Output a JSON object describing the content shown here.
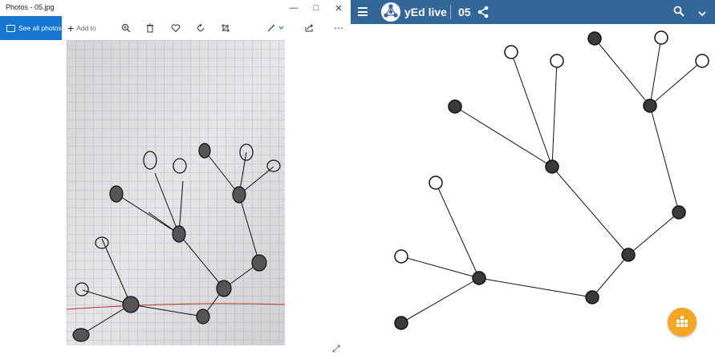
{
  "photos_window": {
    "title": "Photos - 05.jpg",
    "toolbar": {
      "see_all_label": "See all photos",
      "add_to_label": "Add to",
      "icons": [
        "zoom-in-icon",
        "delete-icon",
        "heart-icon",
        "rotate-icon",
        "crop-icon",
        "edit-icon",
        "share-icon",
        "more-icon"
      ]
    },
    "accent_color": "#1677d2"
  },
  "yed_window": {
    "app_name": "yEd live",
    "file_name": "05",
    "header_color": "#336699",
    "fab_color": "#f5a623",
    "graph": {
      "node_colors": {
        "filled": "#3a3a3a",
        "empty": "#ffffff"
      }
    }
  }
}
